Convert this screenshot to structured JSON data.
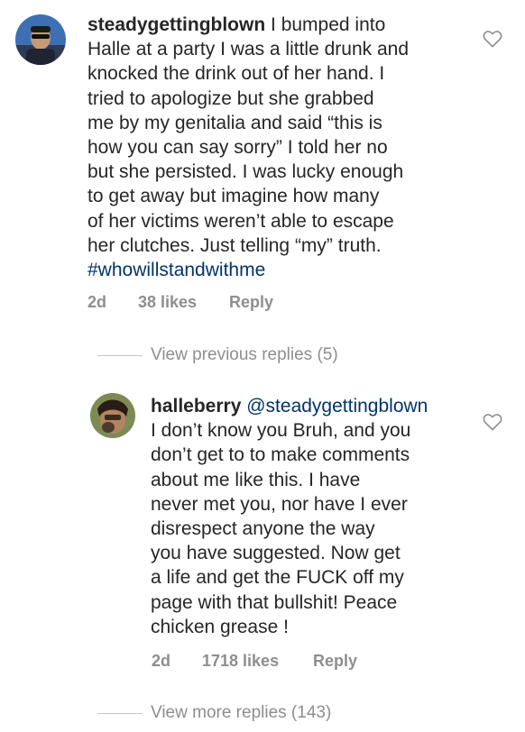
{
  "comments": [
    {
      "username": "steadygettingblown",
      "body_lines": [
        " I bumped into",
        "Halle at a party I was a little drunk and",
        "knocked the drink out of her hand. I",
        "tried to apologize but she grabbed",
        "me by my genitalia and said “this is",
        "how you can say sorry” I told her no",
        "but she persisted. I was lucky enough",
        "to get away but imagine how many",
        "of her victims weren’t able to escape",
        "her clutches. Just telling “my” truth."
      ],
      "hashtag": "#whowillstandwithme",
      "time": "2d",
      "likes": "38 likes",
      "reply": "Reply",
      "like_icon": "heart-outline-icon"
    },
    {
      "username": "halleberry",
      "mention": "@steadygettingblown",
      "body_lines": [
        "I don’t know you Bruh, and you",
        "don’t get to to make comments",
        "about me like this. I have",
        "never met you, nor have  I ever",
        "disrespect anyone the way",
        "you have suggested. Now get",
        "a life and get the FUCK off my",
        "page with that bullshit!  Peace",
        "chicken grease !"
      ],
      "time": "2d",
      "likes": "1718 likes",
      "reply": "Reply",
      "like_icon": "heart-outline-icon"
    }
  ],
  "view_previous": "View previous replies (5)",
  "view_more": "View more replies (143)",
  "colors": {
    "text": "#262626",
    "meta": "#8e8e8e",
    "link": "#003569"
  }
}
